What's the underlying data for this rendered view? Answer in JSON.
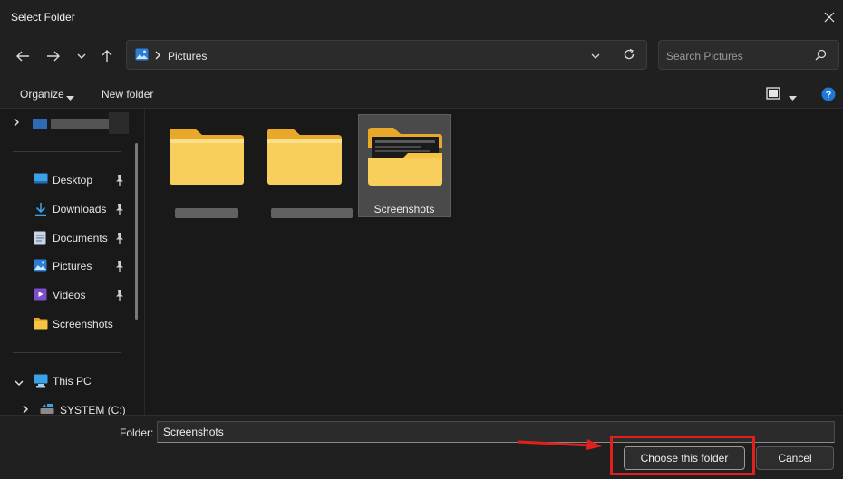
{
  "window": {
    "title": "Select Folder"
  },
  "address": {
    "segment": "Pictures"
  },
  "search": {
    "placeholder": "Search Pictures"
  },
  "commands": {
    "organize": "Organize",
    "new_folder": "New folder"
  },
  "nav": {
    "quick_access": [
      {
        "label": "Desktop",
        "icon": "desktop-icon",
        "pinned": true
      },
      {
        "label": "Downloads",
        "icon": "download-icon",
        "pinned": true
      },
      {
        "label": "Documents",
        "icon": "document-icon",
        "pinned": true
      },
      {
        "label": "Pictures",
        "icon": "pictures-icon",
        "pinned": true
      },
      {
        "label": "Videos",
        "icon": "videos-icon",
        "pinned": true
      },
      {
        "label": "Screenshots",
        "icon": "folder-icon",
        "pinned": false
      }
    ],
    "this_pc": "This PC",
    "drive": "SYSTEM (C:)"
  },
  "folders": [
    {
      "label": "",
      "redacted": true
    },
    {
      "label": "",
      "redacted": true
    },
    {
      "label": "Screenshots",
      "redacted": false,
      "selected": true
    }
  ],
  "footer": {
    "folder_label": "Folder:",
    "folder_value": "Screenshots",
    "choose_label": "Choose this folder",
    "cancel_label": "Cancel"
  },
  "colors": {
    "accent": "#0078d4",
    "highlight": "#e0201c",
    "folder": "#f6c343"
  }
}
